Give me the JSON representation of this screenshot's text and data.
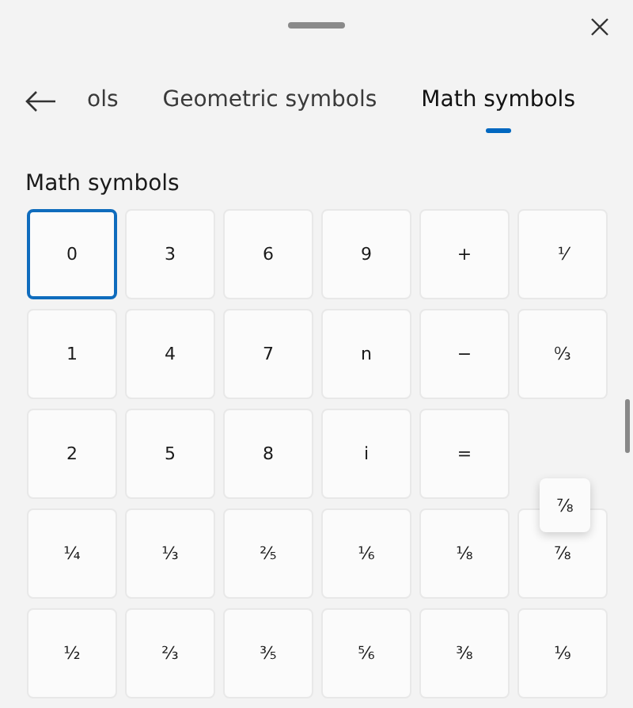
{
  "tabs": [
    {
      "label": "ols",
      "selected": false
    },
    {
      "label": "Geometric symbols",
      "selected": false
    },
    {
      "label": "Math symbols",
      "selected": true
    }
  ],
  "section_title": "Math symbols",
  "keys": [
    [
      {
        "label": "0",
        "selected": true
      },
      {
        "label": "3",
        "selected": false
      },
      {
        "label": "6",
        "selected": false
      },
      {
        "label": "9",
        "selected": false
      },
      {
        "label": "+",
        "selected": false
      },
      {
        "label": "⅟",
        "selected": false
      }
    ],
    [
      {
        "label": "1",
        "selected": false
      },
      {
        "label": "4",
        "selected": false
      },
      {
        "label": "7",
        "selected": false
      },
      {
        "label": "n",
        "selected": false
      },
      {
        "label": "−",
        "selected": false
      },
      {
        "label": "↉",
        "selected": false
      }
    ],
    [
      {
        "label": "2",
        "selected": false
      },
      {
        "label": "5",
        "selected": false
      },
      {
        "label": "8",
        "selected": false
      },
      {
        "label": "i",
        "selected": false
      },
      {
        "label": "=",
        "selected": false
      }
    ],
    [
      {
        "label": "¼",
        "selected": false
      },
      {
        "label": "⅓",
        "selected": false
      },
      {
        "label": "⅖",
        "selected": false
      },
      {
        "label": "⅙",
        "selected": false
      },
      {
        "label": "⅛",
        "selected": false
      },
      {
        "label": "⅞",
        "selected": false
      }
    ],
    [
      {
        "label": "½",
        "selected": false
      },
      {
        "label": "⅔",
        "selected": false
      },
      {
        "label": "⅗",
        "selected": false
      },
      {
        "label": "⅚",
        "selected": false
      },
      {
        "label": "⅜",
        "selected": false
      },
      {
        "label": "⅑",
        "selected": false
      }
    ]
  ],
  "key_tooltip": {
    "label": "⅞"
  }
}
